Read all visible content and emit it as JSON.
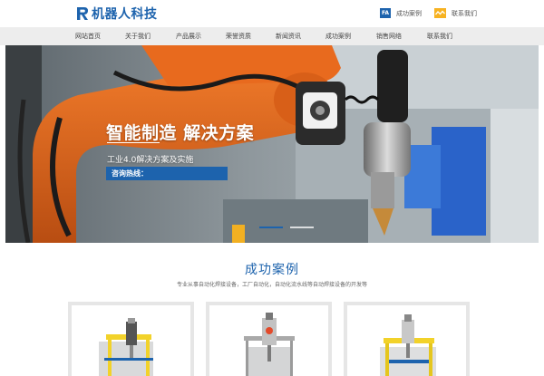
{
  "header": {
    "logo_text": "机器人科技",
    "logo_icon": "r-logo-icon",
    "links": [
      {
        "badge": "FA",
        "label": "成功案例",
        "icon": "fa-badge-icon"
      },
      {
        "label": "联系我们",
        "icon": "wave-badge-icon"
      }
    ]
  },
  "nav": {
    "items": [
      "网站首页",
      "关于我们",
      "产品展示",
      "荣誉资质",
      "新闻资讯",
      "成功案例",
      "销售网络",
      "联系我们"
    ]
  },
  "banner": {
    "title": "智能制造 解决方案",
    "subtitle": "工业4.0解决方案及实施",
    "hotline": "咨询热线：",
    "slides": 3,
    "active_slide": 1
  },
  "cases": {
    "title": "成功案例",
    "subtitle": "专业从事自动化焊接设备，工厂自动化，自动化流水线等自动焊接设备的开发等"
  },
  "colors": {
    "brand_blue": "#1d63ad",
    "accent_yellow": "#f7b221",
    "robot_orange": "#e0641c",
    "nav_bg": "#ededed"
  }
}
